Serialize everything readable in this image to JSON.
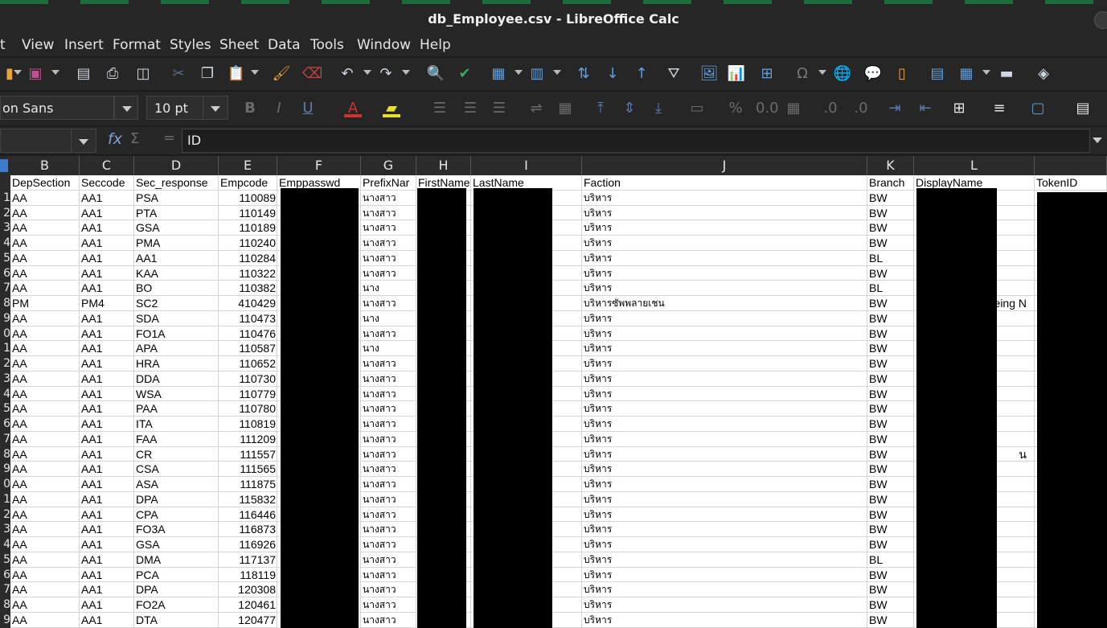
{
  "window": {
    "title": "db_Employee.csv - LibreOffice Calc"
  },
  "menu": [
    "t",
    "View",
    "Insert",
    "Format",
    "Styles",
    "Sheet",
    "Data",
    "Tools",
    "Window",
    "Help"
  ],
  "format_bar": {
    "font_name": "on Sans",
    "font_size": "10 pt"
  },
  "formula_bar": {
    "fx": "fx",
    "sigma": "Σ",
    "equals": "=",
    "content": "ID"
  },
  "columns": [
    "B",
    "C",
    "D",
    "E",
    "F",
    "G",
    "H",
    "I",
    "J",
    "K",
    "L"
  ],
  "header_row": [
    "DepSection",
    "Seccode",
    "Sec_response",
    "Empcode",
    "Emppasswd",
    "PrefixNar",
    "FirstName",
    "LastName",
    "Faction",
    "Branch",
    "DisplayName",
    "TokenID"
  ],
  "rows": [
    {
      "n": "1",
      "b": "AA",
      "c": "AA1",
      "d": "PSA",
      "e": "110089",
      "g": "นางสาว",
      "j": "บริหาร",
      "k": "BW"
    },
    {
      "n": "2",
      "b": "AA",
      "c": "AA1",
      "d": "PTA",
      "e": "110149",
      "g": "นางสาว",
      "j": "บริหาร",
      "k": "BW"
    },
    {
      "n": "3",
      "b": "AA",
      "c": "AA1",
      "d": "GSA",
      "e": "110189",
      "g": "นางสาว",
      "j": "บริหาร",
      "k": "BW"
    },
    {
      "n": "4",
      "b": "AA",
      "c": "AA1",
      "d": "PMA",
      "e": "110240",
      "g": "นางสาว",
      "j": "บริหาร",
      "k": "BW"
    },
    {
      "n": "5",
      "b": "AA",
      "c": "AA1",
      "d": "AA1",
      "e": "110284",
      "g": "นางสาว",
      "j": "บริหาร",
      "k": "BL"
    },
    {
      "n": "6",
      "b": "AA",
      "c": "AA1",
      "d": "KAA",
      "e": "110322",
      "g": "นางสาว",
      "j": "บริหาร",
      "k": "BW"
    },
    {
      "n": "7",
      "b": "AA",
      "c": "AA1",
      "d": "BO",
      "e": "110382",
      "g": "นาง",
      "j": "บริหาร",
      "k": "BL"
    },
    {
      "n": "8",
      "b": "PM",
      "c": "PM4",
      "d": "SC2",
      "e": "410429",
      "g": "นางสาว",
      "j": "บริหารซัพพลายเชน",
      "k": "BW",
      "l": "eing N"
    },
    {
      "n": "9",
      "b": "AA",
      "c": "AA1",
      "d": "SDA",
      "e": "110473",
      "g": "นาง",
      "j": "บริหาร",
      "k": "BW"
    },
    {
      "n": "0",
      "b": "AA",
      "c": "AA1",
      "d": "FO1A",
      "e": "110476",
      "g": "นางสาว",
      "j": "บริหาร",
      "k": "BW"
    },
    {
      "n": "1",
      "b": "AA",
      "c": "AA1",
      "d": "APA",
      "e": "110587",
      "g": "นาง",
      "j": "บริหาร",
      "k": "BW"
    },
    {
      "n": "2",
      "b": "AA",
      "c": "AA1",
      "d": "HRA",
      "e": "110652",
      "g": "นางสาว",
      "j": "บริหาร",
      "k": "BW"
    },
    {
      "n": "3",
      "b": "AA",
      "c": "AA1",
      "d": "DDA",
      "e": "110730",
      "g": "นางสาว",
      "j": "บริหาร",
      "k": "BW"
    },
    {
      "n": "4",
      "b": "AA",
      "c": "AA1",
      "d": "WSA",
      "e": "110779",
      "g": "นางสาว",
      "j": "บริหาร",
      "k": "BW"
    },
    {
      "n": "5",
      "b": "AA",
      "c": "AA1",
      "d": "PAA",
      "e": "110780",
      "g": "นางสาว",
      "j": "บริหาร",
      "k": "BW"
    },
    {
      "n": "6",
      "b": "AA",
      "c": "AA1",
      "d": "ITA",
      "e": "110819",
      "g": "นางสาว",
      "j": "บริหาร",
      "k": "BW"
    },
    {
      "n": "7",
      "b": "AA",
      "c": "AA1",
      "d": "FAA",
      "e": "111209",
      "g": "นางสาว",
      "j": "บริหาร",
      "k": "BW"
    },
    {
      "n": "8",
      "b": "AA",
      "c": "AA1",
      "d": "CR",
      "e": "111557",
      "g": "นางสาว",
      "j": "บริหาร",
      "k": "BW",
      "l": "น"
    },
    {
      "n": "9",
      "b": "AA",
      "c": "AA1",
      "d": "CSA",
      "e": "111565",
      "g": "นางสาว",
      "j": "บริหาร",
      "k": "BW"
    },
    {
      "n": "0",
      "b": "AA",
      "c": "AA1",
      "d": "ASA",
      "e": "111875",
      "g": "นางสาว",
      "j": "บริหาร",
      "k": "BW"
    },
    {
      "n": "1",
      "b": "AA",
      "c": "AA1",
      "d": "DPA",
      "e": "115832",
      "g": "นางสาว",
      "j": "บริหาร",
      "k": "BW"
    },
    {
      "n": "2",
      "b": "AA",
      "c": "AA1",
      "d": "CPA",
      "e": "116446",
      "g": "นางสาว",
      "j": "บริหาร",
      "k": "BW"
    },
    {
      "n": "3",
      "b": "AA",
      "c": "AA1",
      "d": "FO3A",
      "e": "116873",
      "g": "นางสาว",
      "j": "บริหาร",
      "k": "BW"
    },
    {
      "n": "4",
      "b": "AA",
      "c": "AA1",
      "d": "GSA",
      "e": "116926",
      "g": "นางสาว",
      "j": "บริหาร",
      "k": "BW"
    },
    {
      "n": "5",
      "b": "AA",
      "c": "AA1",
      "d": "DMA",
      "e": "117137",
      "g": "นางสาว",
      "j": "บริหาร",
      "k": "BL"
    },
    {
      "n": "6",
      "b": "AA",
      "c": "AA1",
      "d": "PCA",
      "e": "118119",
      "g": "นางสาว",
      "j": "บริหาร",
      "k": "BW"
    },
    {
      "n": "7",
      "b": "AA",
      "c": "AA1",
      "d": "DPA",
      "e": "120308",
      "g": "นางสาว",
      "j": "บริหาร",
      "k": "BW"
    },
    {
      "n": "8",
      "b": "AA",
      "c": "AA1",
      "d": "FO2A",
      "e": "120461",
      "g": "นางสาว",
      "j": "บริหาร",
      "k": "BW"
    },
    {
      "n": "9",
      "b": "AA",
      "c": "AA1",
      "d": "DTA",
      "e": "120477",
      "g": "นางสาว",
      "j": "บริหาร",
      "k": "BW"
    }
  ],
  "colors": {
    "chrome": "#262626",
    "sheet_bg": "#ffffff",
    "grid": "#d5d5d5",
    "redaction": "#000000",
    "accent": "#7aa2d4"
  }
}
